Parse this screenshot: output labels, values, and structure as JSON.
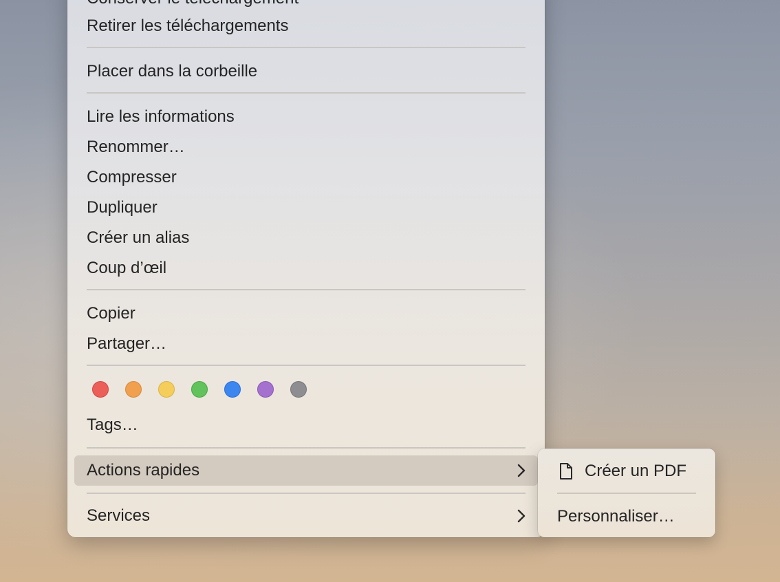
{
  "context_menu": {
    "items": {
      "keep_download": "Conserver le téléchargement",
      "remove_downloads": "Retirer les téléchargements",
      "move_to_trash": "Placer dans la corbeille",
      "get_info": "Lire les informations",
      "rename": "Renommer…",
      "compress": "Compresser",
      "duplicate": "Dupliquer",
      "make_alias": "Créer un alias",
      "quick_look": "Coup d’œil",
      "copy": "Copier",
      "share": "Partager…",
      "tags": "Tags…",
      "quick_actions": "Actions rapides",
      "services": "Services"
    },
    "tag_colors": [
      {
        "name": "red",
        "fill": "#ec5f59",
        "border": "#d54640"
      },
      {
        "name": "orange",
        "fill": "#f0a04e",
        "border": "#d98a3a"
      },
      {
        "name": "yellow",
        "fill": "#f4cd5b",
        "border": "#dbb544"
      },
      {
        "name": "green",
        "fill": "#62c25c",
        "border": "#4aa845"
      },
      {
        "name": "blue",
        "fill": "#3c86f0",
        "border": "#2a6fd6"
      },
      {
        "name": "purple",
        "fill": "#a571cf",
        "border": "#8c59b6"
      },
      {
        "name": "gray",
        "fill": "#8e8e92",
        "border": "#76767a"
      }
    ],
    "icons": {
      "submenu_arrow": "chevron-right-icon"
    }
  },
  "quick_actions_submenu": {
    "items": {
      "create_pdf": "Créer un PDF",
      "customize": "Personnaliser…"
    },
    "icons": {
      "create_pdf": "document-icon"
    }
  }
}
